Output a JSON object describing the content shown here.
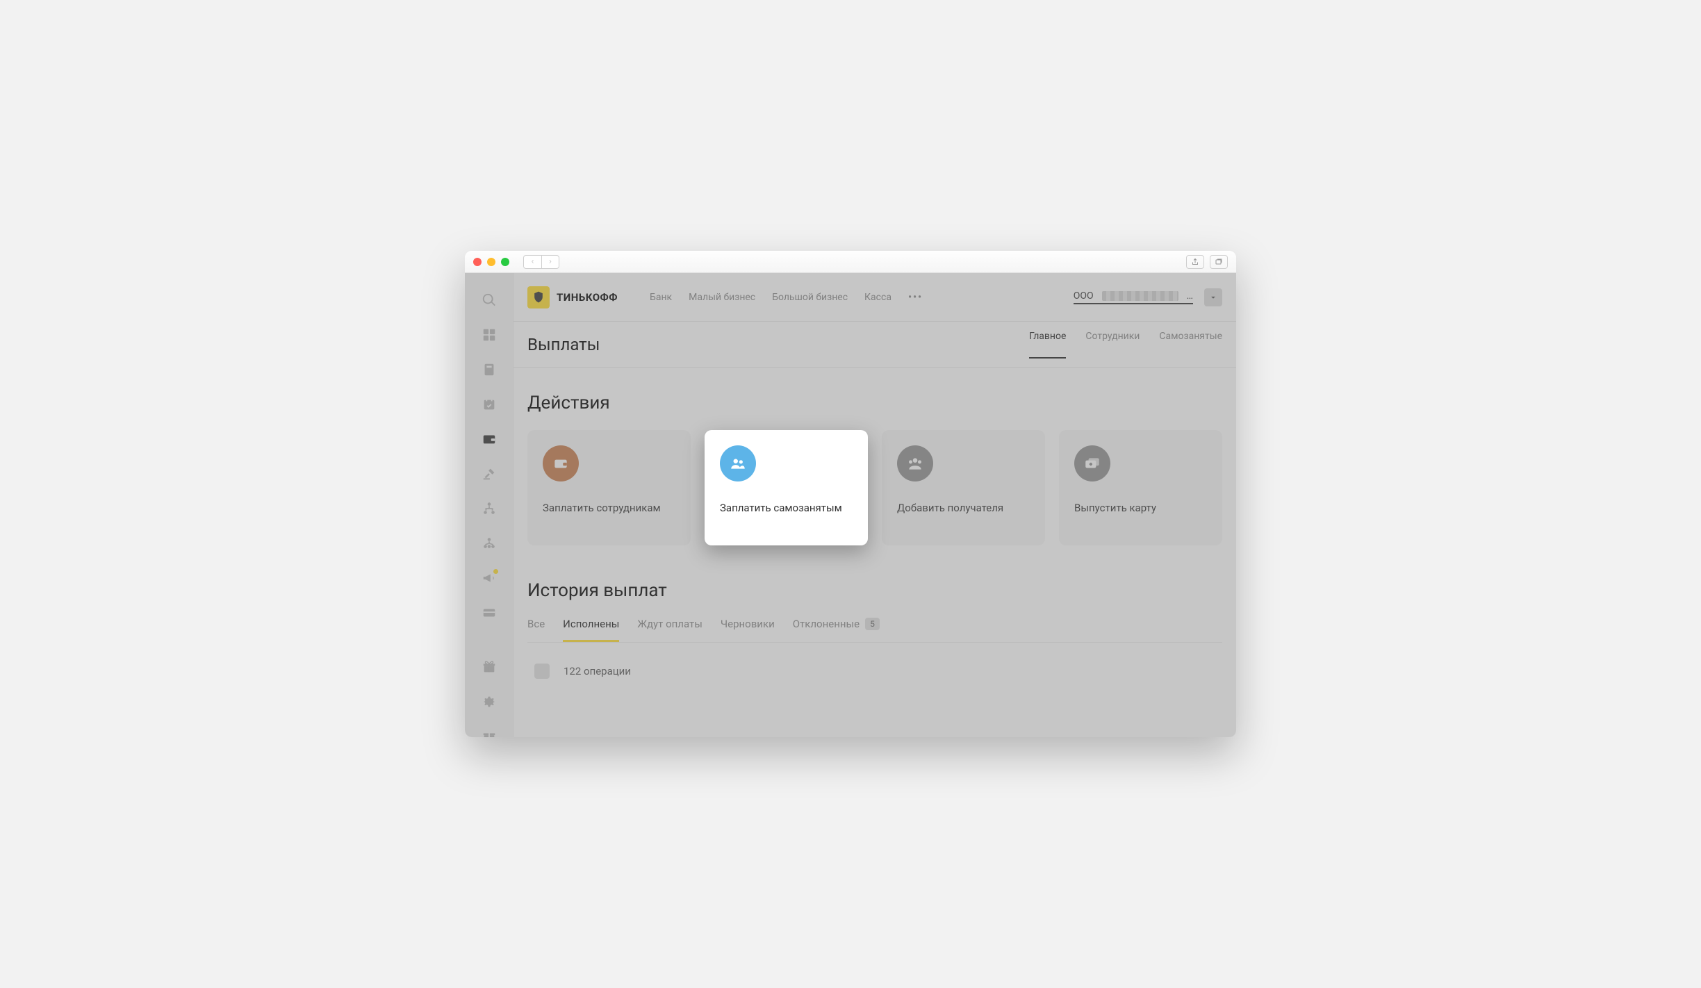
{
  "brand": "ТИНЬКОФФ",
  "topnav": {
    "items": [
      "Банк",
      "Малый бизнес",
      "Большой бизнес",
      "Касса"
    ]
  },
  "org": {
    "prefix": "ООО",
    "suffix": "…"
  },
  "page": {
    "title": "Выплаты"
  },
  "subtabs": {
    "main": "Главное",
    "employees": "Сотрудники",
    "selfemployed": "Самозанятые"
  },
  "actions": {
    "heading": "Действия",
    "cards": {
      "pay_employees": "Заплатить сотрудникам",
      "pay_selfemployed": "Заплатить самозанятым",
      "add_recipient": "Добавить получателя",
      "issue_card": "Выпустить карту"
    }
  },
  "history": {
    "heading": "История выплат",
    "tabs": {
      "all": "Все",
      "done": "Исполнены",
      "pending": "Ждут оплаты",
      "drafts": "Черновики",
      "rejected": "Отклоненные",
      "rejected_count": "5"
    },
    "operations_label": "122 операции"
  }
}
